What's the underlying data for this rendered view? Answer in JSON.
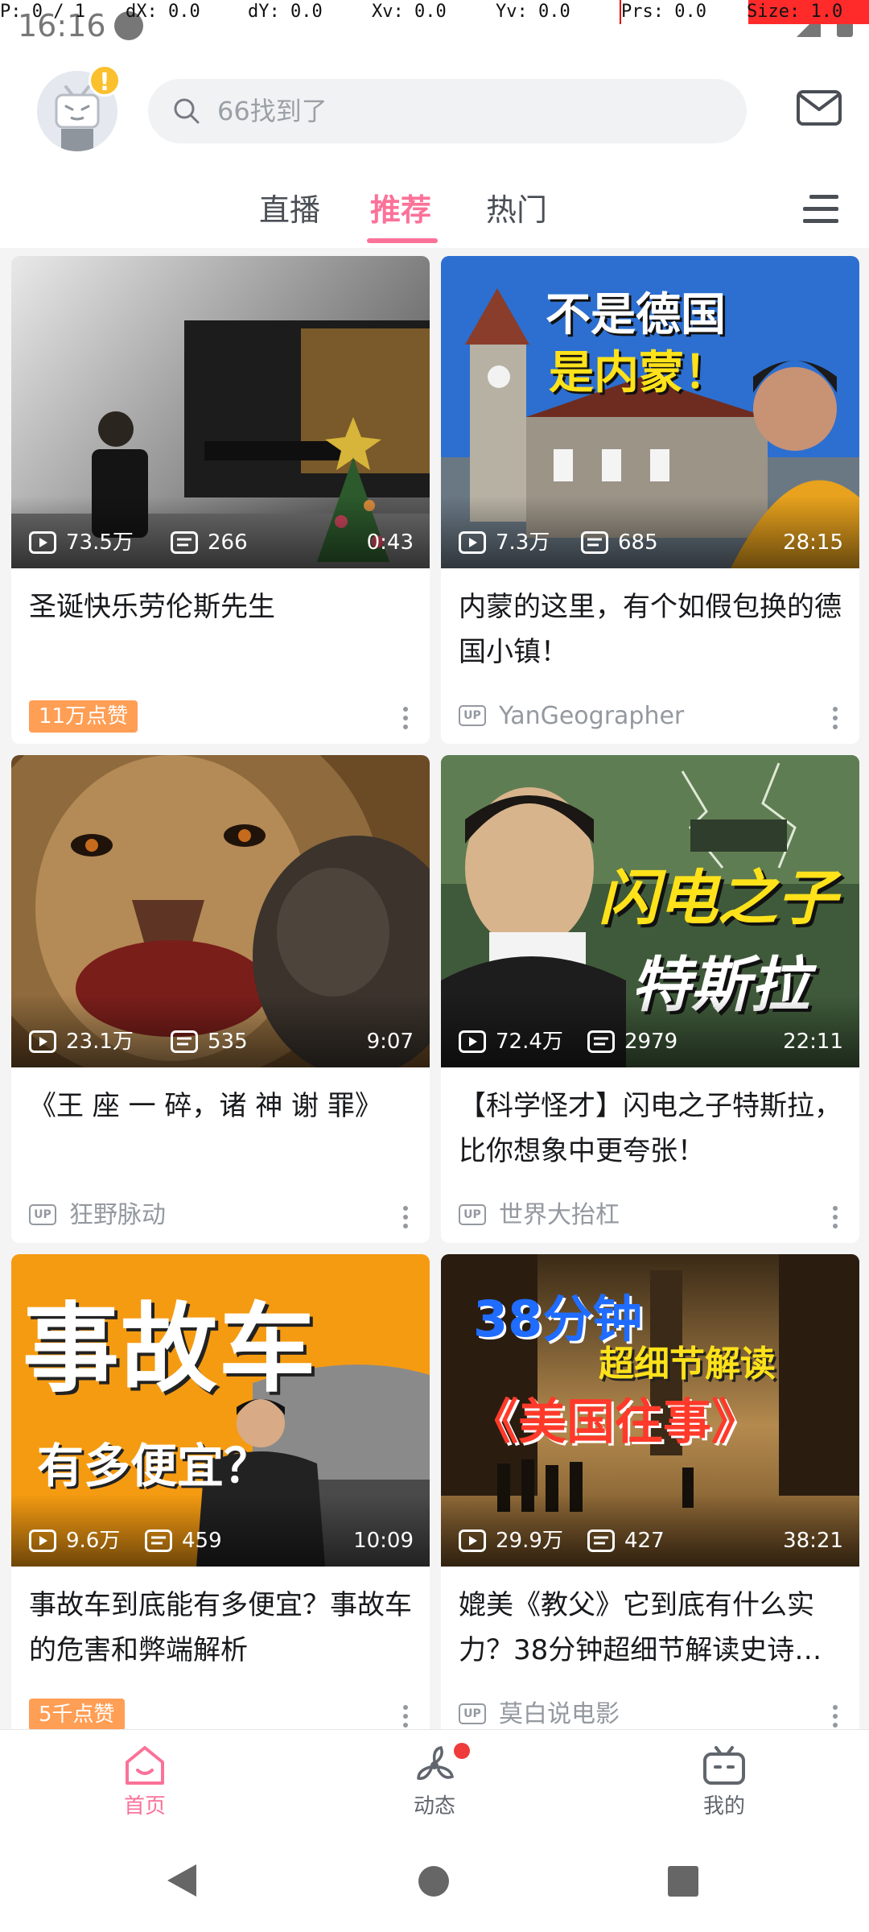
{
  "status_bar": {
    "time": "16:16",
    "debug": {
      "pointer": "P: 0 / 1",
      "dx": "dX: 0.0",
      "dy": "dY: 0.0",
      "xv": "Xv: 0.0",
      "yv": "Yv: 0.0",
      "prs": "Prs: 0.0",
      "size": "Size: 1.0"
    }
  },
  "header": {
    "search_placeholder": "66找到了",
    "avatar_badge": "!",
    "tabs": [
      {
        "label": "直播",
        "active": false
      },
      {
        "label": "推荐",
        "active": true
      },
      {
        "label": "热门",
        "active": false
      }
    ]
  },
  "feed": [
    {
      "title": "圣诞快乐劳伦斯先生",
      "plays": "73.5万",
      "danmaku": "266",
      "duration": "0:43",
      "meta_type": "likes",
      "likes": "11万点赞"
    },
    {
      "title": "内蒙的这里，有个如假包换的德国小镇！",
      "plays": "7.3万",
      "danmaku": "685",
      "duration": "28:15",
      "meta_type": "up",
      "up_name": "YanGeographer"
    },
    {
      "title": "《王 座 一 碎，诸 神 谢 罪》",
      "plays": "23.1万",
      "danmaku": "535",
      "duration": "9:07",
      "meta_type": "up",
      "up_name": "狂野脉动"
    },
    {
      "title": "【科学怪才】闪电之子特斯拉，比你想象中更夸张！",
      "plays": "72.4万",
      "danmaku": "2979",
      "duration": "22:11",
      "meta_type": "up",
      "up_name": "世界大抬杠"
    },
    {
      "title": "事故车到底能有多便宜？事故车的危害和弊端解析",
      "plays": "9.6万",
      "danmaku": "459",
      "duration": "10:09",
      "meta_type": "likes",
      "likes": "5千点赞"
    },
    {
      "title": "媲美《教父》它到底有什么实力？38分钟超细节解读史诗…",
      "plays": "29.9万",
      "danmaku": "427",
      "duration": "38:21",
      "meta_type": "up",
      "up_name": "莫白说电影"
    }
  ],
  "thumb_text": {
    "card2_line1": "不是德国",
    "card2_line2": "是内蒙！",
    "card4_line1": "闪电之子",
    "card4_line2": "特斯拉",
    "card5_line1": "事故车",
    "card5_line2": "有多便宜？",
    "card6_line1": "38分钟",
    "card6_line2": "超细节解读",
    "card6_line3": "《美国往事》"
  },
  "up_badge": "UP",
  "bottom_nav": [
    {
      "label": "首页",
      "active": true
    },
    {
      "label": "动态",
      "active": false
    },
    {
      "label": "我的",
      "active": false
    }
  ],
  "colors": {
    "accent": "#fb7299",
    "likes_badge": "#ff9e55",
    "muted": "#9499a0"
  },
  "icons": [
    "search-icon",
    "mail-icon",
    "menu-icon",
    "play-icon",
    "danmaku-icon",
    "more-icon",
    "home-icon",
    "dynamic-icon",
    "tv-icon"
  ]
}
